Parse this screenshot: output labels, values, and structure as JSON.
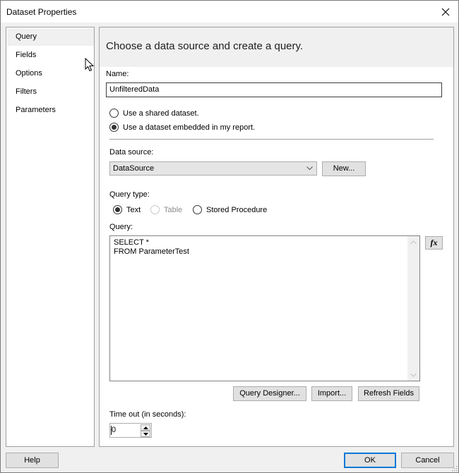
{
  "window": {
    "title": "Dataset Properties",
    "close_icon": "close-icon"
  },
  "nav": {
    "items": [
      {
        "label": "Query",
        "selected": true
      },
      {
        "label": "Fields",
        "selected": false
      },
      {
        "label": "Options",
        "selected": false
      },
      {
        "label": "Filters",
        "selected": false
      },
      {
        "label": "Parameters",
        "selected": false
      }
    ]
  },
  "content": {
    "header": "Choose a data source and create a query.",
    "name_label": "Name:",
    "name_value": "UnfilteredData",
    "radio_shared": "Use a shared dataset.",
    "radio_embedded": "Use a dataset embedded in my report.",
    "dataset_mode": "embedded",
    "datasource_label": "Data source:",
    "datasource_value": "DataSource",
    "new_button": "New...",
    "query_type_label": "Query type:",
    "query_types": [
      {
        "label": "Text",
        "checked": true,
        "disabled": false
      },
      {
        "label": "Table",
        "checked": false,
        "disabled": true
      },
      {
        "label": "Stored Procedure",
        "checked": false,
        "disabled": false
      }
    ],
    "query_label": "Query:",
    "query_text": "SELECT *\nFROM ParameterTest",
    "fx_button": "fx",
    "query_designer_button": "Query Designer...",
    "import_button": "Import...",
    "refresh_fields_button": "Refresh Fields",
    "timeout_label": "Time out (in seconds):",
    "timeout_value": "0"
  },
  "footer": {
    "help_button": "Help",
    "ok_button": "OK",
    "cancel_button": "Cancel"
  },
  "colors": {
    "accent": "#0078d7",
    "selected_nav": "#f0f0f0",
    "button_bg": "#e1e1e1"
  }
}
